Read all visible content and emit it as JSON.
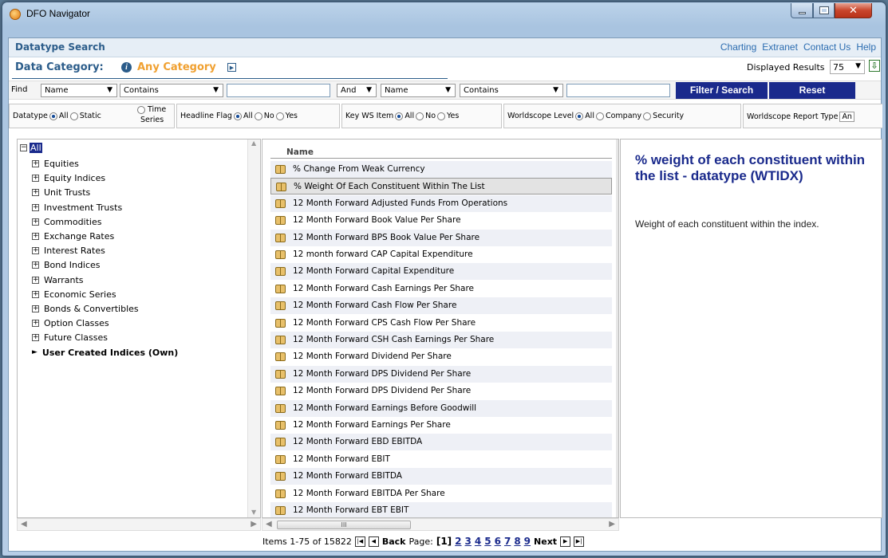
{
  "window": {
    "title": "DFO Navigator"
  },
  "header": {
    "page_name": "Datatype Search",
    "links": [
      "Charting",
      "Extranet",
      "Contact Us",
      "Help"
    ]
  },
  "category": {
    "label": "Data Category:",
    "value": "Any Category"
  },
  "displayed": {
    "label": "Displayed Results",
    "value": "75"
  },
  "find": {
    "label": "Find",
    "field1": "Name",
    "op1": "Contains",
    "value1": "",
    "joiner": "And",
    "field2": "Name",
    "op2": "Contains",
    "value2": "",
    "filter_button": "Filter / Search",
    "reset_button": "Reset"
  },
  "filters": {
    "datatype": {
      "label": "Datatype",
      "opts": [
        "All",
        "Static",
        "Time",
        "Series"
      ]
    },
    "headline": {
      "label": "Headline Flag",
      "opts": [
        "All",
        "No",
        "Yes"
      ]
    },
    "keyws": {
      "label": "Key WS Item",
      "opts": [
        "All",
        "No",
        "Yes"
      ]
    },
    "wslevel": {
      "label": "Worldscope Level",
      "opts": [
        "All",
        "Company",
        "Security"
      ]
    },
    "wsreport": {
      "label": "Worldscope Report Type",
      "value": "An"
    }
  },
  "tree": {
    "root": "All",
    "items": [
      "Equities",
      "Equity Indices",
      "Unit Trusts",
      "Investment Trusts",
      "Commodities",
      "Exchange Rates",
      "Interest Rates",
      "Bond Indices",
      "Warrants",
      "Economic Series",
      "Bonds & Convertibles",
      "Option Classes",
      "Future Classes"
    ],
    "user_item": "User Created Indices (Own)"
  },
  "list": {
    "header": "Name",
    "rows": [
      "% Change From Weak Currency",
      "% Weight Of Each Constituent Within The List",
      "12 Month Forward Adjusted Funds From Operations",
      "12 Month Forward Book Value Per Share",
      "12 Month Forward BPS Book Value Per Share",
      "12 month forward CAP Capital Expenditure",
      "12 Month Forward Capital Expenditure",
      "12 Month Forward Cash Earnings Per Share",
      "12 Month Forward Cash Flow Per Share",
      "12 Month Forward CPS Cash Flow Per Share",
      "12 Month Forward CSH Cash Earnings Per Share",
      "12 Month Forward Dividend Per Share",
      "12 Month Forward DPS Dividend Per Share",
      "12 Month Forward DPS Dividend Per Share",
      "12 Month Forward Earnings Before Goodwill",
      "12 Month Forward Earnings Per Share",
      "12 Month Forward EBD EBITDA",
      "12 Month Forward EBIT",
      "12 Month Forward EBITDA",
      "12 Month Forward EBITDA Per Share",
      "12 Month Forward EBT EBIT"
    ]
  },
  "detail": {
    "title": "% weight of each constituent within the list - datatype (WTIDX)",
    "description": "Weight of each constituent within the index."
  },
  "pager": {
    "items_text": "Items 1-75 of 15822",
    "back": "Back",
    "page_label": "Page:",
    "current": "[1]",
    "pages": [
      "2",
      "3",
      "4",
      "5",
      "6",
      "7",
      "8",
      "9"
    ],
    "next": "Next"
  }
}
